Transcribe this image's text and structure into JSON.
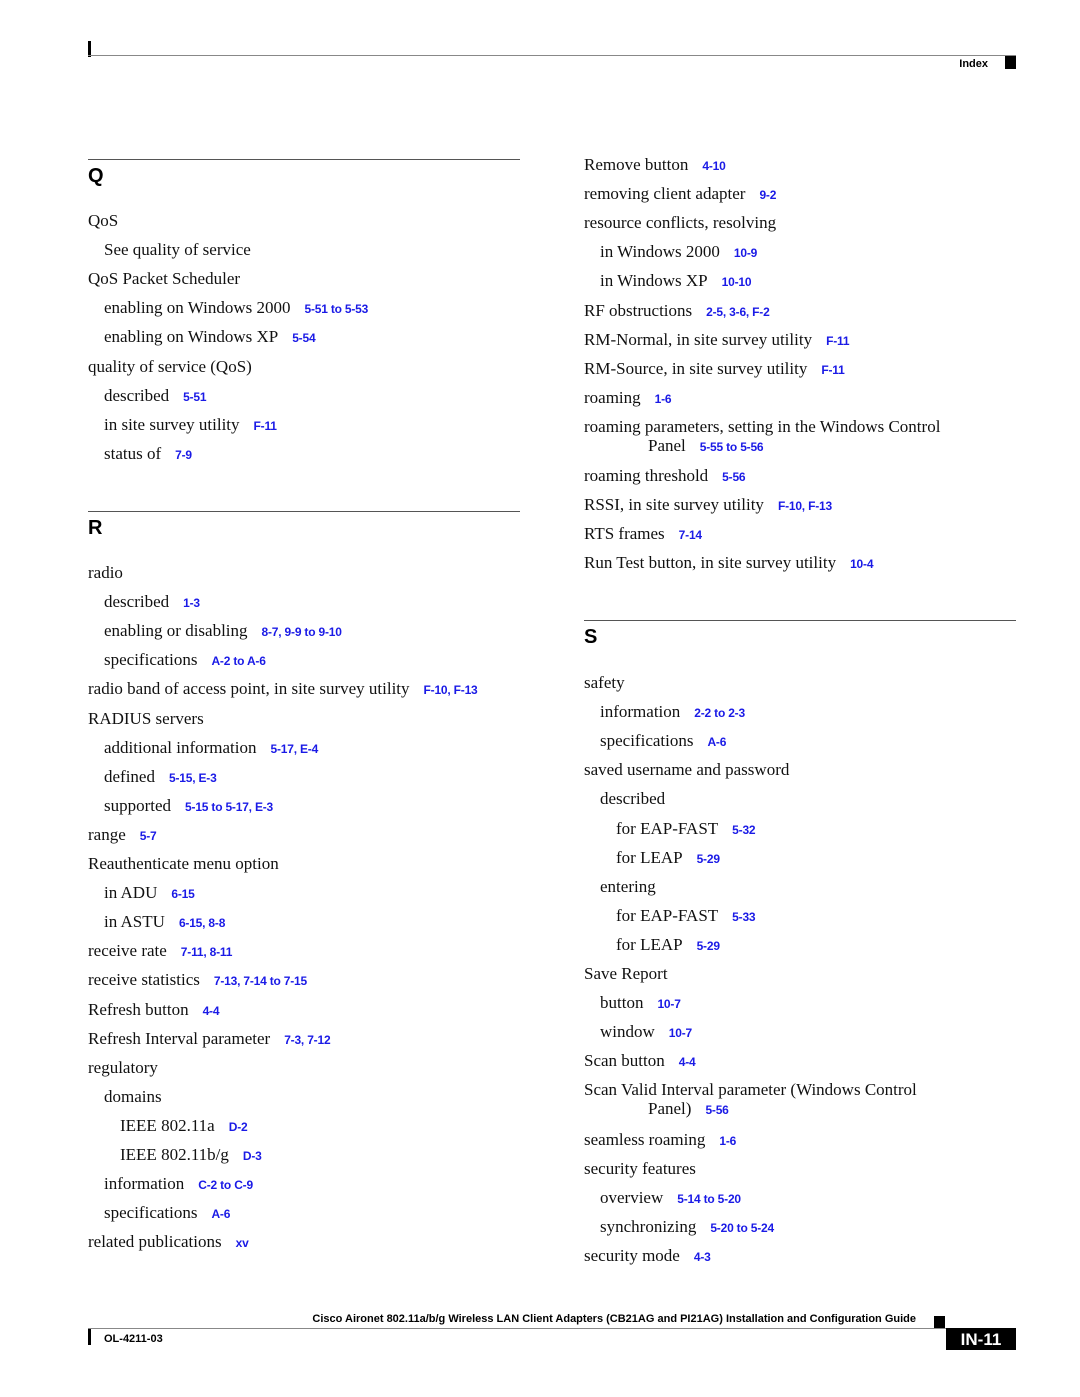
{
  "header": {
    "section_label": "Index"
  },
  "footer": {
    "book_title": "Cisco Aironet 802.11a/b/g Wireless LAN Client Adapters (CB21AG and PI21AG) Installation and Configuration Guide",
    "doc_number": "OL-4211-03",
    "page_number": "IN-11"
  },
  "colors": {
    "link": "#1a1ae6",
    "text": "#111111"
  },
  "sections": {
    "q": {
      "letter": "Q",
      "entries": [
        {
          "level": 1,
          "text": "QoS",
          "ref": ""
        },
        {
          "level": 2,
          "text": "See quality of service",
          "ref": ""
        },
        {
          "level": 1,
          "text": "QoS Packet Scheduler",
          "ref": ""
        },
        {
          "level": 2,
          "text": "enabling on Windows 2000",
          "ref": "5-51 to 5-53"
        },
        {
          "level": 2,
          "text": "enabling on Windows XP",
          "ref": "5-54"
        },
        {
          "level": 1,
          "text": "quality of service (QoS)",
          "ref": ""
        },
        {
          "level": 2,
          "text": "described",
          "ref": "5-51"
        },
        {
          "level": 2,
          "text": "in site survey utility",
          "ref": "F-11"
        },
        {
          "level": 2,
          "text": "status of",
          "ref": "7-9"
        }
      ]
    },
    "r_left": {
      "letter": "R",
      "entries": [
        {
          "level": 1,
          "text": "radio",
          "ref": ""
        },
        {
          "level": 2,
          "text": "described",
          "ref": "1-3"
        },
        {
          "level": 2,
          "text": "enabling or disabling",
          "ref": "8-7, 9-9 to 9-10"
        },
        {
          "level": 2,
          "text": "specifications",
          "ref": "A-2 to A-6"
        },
        {
          "level": 1,
          "text": "radio band of access point, in site survey utility",
          "ref": "F-10, F-13"
        },
        {
          "level": 1,
          "text": "RADIUS servers",
          "ref": ""
        },
        {
          "level": 2,
          "text": "additional information",
          "ref": "5-17, E-4"
        },
        {
          "level": 2,
          "text": "defined",
          "ref": "5-15, E-3"
        },
        {
          "level": 2,
          "text": "supported",
          "ref": "5-15 to 5-17, E-3"
        },
        {
          "level": 1,
          "text": "range",
          "ref": "5-7"
        },
        {
          "level": 1,
          "text": "Reauthenticate menu option",
          "ref": ""
        },
        {
          "level": 2,
          "text": "in ADU",
          "ref": "6-15"
        },
        {
          "level": 2,
          "text": "in ASTU",
          "ref": "6-15, 8-8"
        },
        {
          "level": 1,
          "text": "receive rate",
          "ref": "7-11, 8-11"
        },
        {
          "level": 1,
          "text": "receive statistics",
          "ref": "7-13, 7-14 to 7-15"
        },
        {
          "level": 1,
          "text": "Refresh button",
          "ref": "4-4"
        },
        {
          "level": 1,
          "text": "Refresh Interval parameter",
          "ref": "7-3, 7-12"
        },
        {
          "level": 1,
          "text": "regulatory",
          "ref": ""
        },
        {
          "level": 2,
          "text": "domains",
          "ref": ""
        },
        {
          "level": 3,
          "text": "IEEE 802.11a",
          "ref": "D-2"
        },
        {
          "level": 3,
          "text": "IEEE 802.11b/g",
          "ref": "D-3"
        },
        {
          "level": 2,
          "text": "information",
          "ref": "C-2 to C-9"
        },
        {
          "level": 2,
          "text": "specifications",
          "ref": "A-6"
        },
        {
          "level": 1,
          "text": "related publications",
          "ref": "xv"
        }
      ]
    },
    "r_right": {
      "entries": [
        {
          "level": 1,
          "text": "Remove button",
          "ref": "4-10"
        },
        {
          "level": 1,
          "text": "removing client adapter",
          "ref": "9-2"
        },
        {
          "level": 1,
          "text": "resource conflicts, resolving",
          "ref": ""
        },
        {
          "level": 2,
          "text": "in Windows 2000",
          "ref": "10-9"
        },
        {
          "level": 2,
          "text": "in Windows XP",
          "ref": "10-10"
        },
        {
          "level": 1,
          "text": "RF obstructions",
          "ref": "2-5, 3-6, F-2"
        },
        {
          "level": 1,
          "text": "RM-Normal, in site survey utility",
          "ref": "F-11"
        },
        {
          "level": 1,
          "text": "RM-Source, in site survey utility",
          "ref": "F-11"
        },
        {
          "level": 1,
          "text": "roaming",
          "ref": "1-6"
        },
        {
          "level": 1,
          "text": "roaming parameters, setting in the Windows Control",
          "cont": "Panel",
          "ref": "5-55 to 5-56"
        },
        {
          "level": 1,
          "text": "roaming threshold",
          "ref": "5-56"
        },
        {
          "level": 1,
          "text": "RSSI, in site survey utility",
          "ref": "F-10, F-13"
        },
        {
          "level": 1,
          "text": "RTS frames",
          "ref": "7-14"
        },
        {
          "level": 1,
          "text": "Run Test button, in site survey utility",
          "ref": "10-4"
        }
      ]
    },
    "s": {
      "letter": "S",
      "entries": [
        {
          "level": 1,
          "text": "safety",
          "ref": ""
        },
        {
          "level": 2,
          "text": "information",
          "ref": "2-2 to 2-3"
        },
        {
          "level": 2,
          "text": "specifications",
          "ref": "A-6"
        },
        {
          "level": 1,
          "text": "saved username and password",
          "ref": ""
        },
        {
          "level": 2,
          "text": "described",
          "ref": ""
        },
        {
          "level": 3,
          "text": "for EAP-FAST",
          "ref": "5-32"
        },
        {
          "level": 3,
          "text": "for LEAP",
          "ref": "5-29"
        },
        {
          "level": 2,
          "text": "entering",
          "ref": ""
        },
        {
          "level": 3,
          "text": "for EAP-FAST",
          "ref": "5-33"
        },
        {
          "level": 3,
          "text": "for LEAP",
          "ref": "5-29"
        },
        {
          "level": 1,
          "text": "Save Report",
          "ref": ""
        },
        {
          "level": 2,
          "text": "button",
          "ref": "10-7"
        },
        {
          "level": 2,
          "text": "window",
          "ref": "10-7"
        },
        {
          "level": 1,
          "text": "Scan button",
          "ref": "4-4"
        },
        {
          "level": 1,
          "text": "Scan Valid Interval parameter (Windows Control",
          "cont": "Panel)",
          "ref": "5-56"
        },
        {
          "level": 1,
          "text": "seamless roaming",
          "ref": "1-6"
        },
        {
          "level": 1,
          "text": "security features",
          "ref": ""
        },
        {
          "level": 2,
          "text": "overview",
          "ref": "5-14 to 5-20"
        },
        {
          "level": 2,
          "text": "synchronizing",
          "ref": "5-20 to 5-24"
        },
        {
          "level": 1,
          "text": "security mode",
          "ref": "4-3"
        }
      ]
    }
  }
}
